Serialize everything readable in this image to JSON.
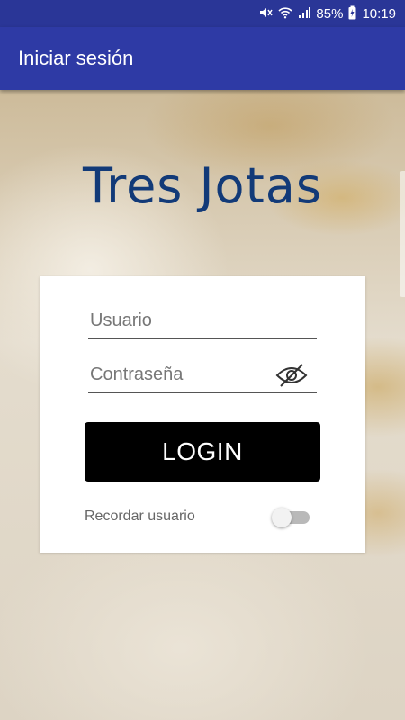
{
  "status_bar": {
    "battery": "85%",
    "time": "10:19",
    "icons": [
      "mute-icon",
      "wifi-icon",
      "signal-icon",
      "battery-icon"
    ]
  },
  "app_bar": {
    "title": "Iniciar sesión"
  },
  "brand": {
    "name": "Tres Jotas",
    "color": "#123a78"
  },
  "login_form": {
    "username_placeholder": "Usuario",
    "password_placeholder": "Contraseña",
    "password_toggle_icon": "eye-off-icon",
    "login_label": "LOGIN",
    "remember_label": "Recordar usuario",
    "remember_on": false
  },
  "colors": {
    "status_bar": "#2a3697",
    "app_bar": "#2e3aa5",
    "button": "#000000"
  }
}
